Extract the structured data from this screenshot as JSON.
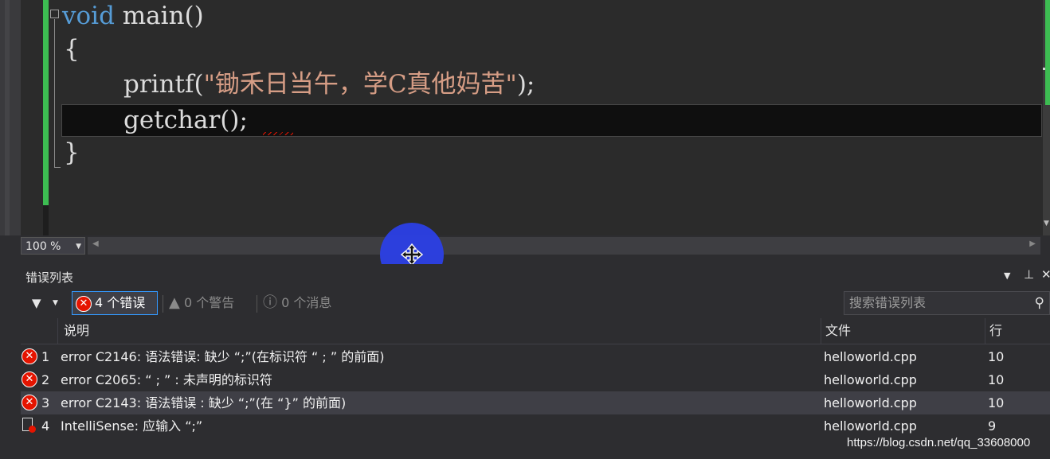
{
  "editor": {
    "lines": [
      {
        "kw": "void",
        "rest": " main()"
      },
      {
        "text": "{"
      },
      {
        "pre": "printf(",
        "str": "\"锄禾日当午，学C真他妈苦\"",
        "post": ");"
      },
      {
        "text": "getchar();"
      },
      {
        "text": "}"
      }
    ],
    "collapse_glyph": "⊟",
    "zoom": "100 %"
  },
  "error_list": {
    "title": "错误列表",
    "filter_errors": "4 个错误",
    "filter_warnings": "0 个警告",
    "filter_messages": "0 个消息",
    "search_placeholder": "搜索错误列表",
    "columns": {
      "description": "说明",
      "file": "文件",
      "line": "行"
    },
    "rows": [
      {
        "num": "1",
        "description": "error C2146: 语法错误: 缺少 “;”(在标识符 “ ; ” 的前面)",
        "file": "helloworld.cpp",
        "line": "10",
        "type": "error"
      },
      {
        "num": "2",
        "description": "error C2065: “ ; ” : 未声明的标识符",
        "file": "helloworld.cpp",
        "line": "10",
        "type": "error"
      },
      {
        "num": "3",
        "description": "error C2143: 语法错误 : 缺少 “;”(在 “}” 的前面)",
        "file": "helloworld.cpp",
        "line": "10",
        "type": "error",
        "selected": true
      },
      {
        "num": "4",
        "description": "IntelliSense:  应输入 “;”",
        "file": "helloworld.cpp",
        "line": "9",
        "type": "intellisense"
      }
    ]
  },
  "watermark": "https://blog.csdn.net/qq_33608000",
  "colors": {
    "accent": "#3399ff",
    "error": "#e51400",
    "change_bar": "#3dbd52",
    "cursor": "#2c40e6"
  }
}
